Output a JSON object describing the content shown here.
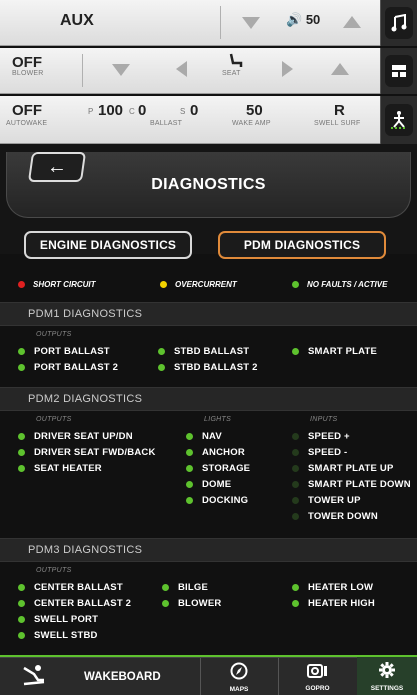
{
  "topbar": {
    "row1": {
      "source": "AUX",
      "volume": "50"
    },
    "row2": {
      "blower_value": "OFF",
      "blower_label": "BLOWER",
      "seat_label": "SEAT"
    },
    "row3": {
      "autowake_value": "OFF",
      "autowake_label": "AUTOWAKE",
      "ballast_p_prefix": "P",
      "ballast_p": "100",
      "ballast_c_prefix": "C",
      "ballast_c": "0",
      "ballast_s_prefix": "S",
      "ballast_s": "0",
      "ballast_label": "BALLAST",
      "wake_amp_value": "50",
      "wake_amp_label": "WAKE AMP",
      "swell_value": "R",
      "swell_label": "SWELL SURF"
    }
  },
  "header": {
    "back_glyph": "←",
    "title": "DIAGNOSTICS",
    "tabs": [
      "ENGINE DIAGNOSTICS",
      "PDM DIAGNOSTICS"
    ]
  },
  "legend": {
    "short_circuit": "SHORT CIRCUIT",
    "overcurrent": "OVERCURRENT",
    "no_faults": "NO FAULTS / ACTIVE"
  },
  "pdm1": {
    "title": "PDM1 DIAGNOSTICS",
    "outputs_label": "OUTPUTS",
    "col1": [
      "PORT BALLAST",
      "PORT BALLAST 2"
    ],
    "col2": [
      "STBD BALLAST",
      "STBD BALLAST 2"
    ],
    "col3": [
      "SMART PLATE"
    ]
  },
  "pdm2": {
    "title": "PDM2 DIAGNOSTICS",
    "outputs_label": "OUTPUTS",
    "lights_label": "LIGHTS",
    "inputs_label": "INPUTS",
    "outputs": [
      "DRIVER SEAT UP/DN",
      "DRIVER SEAT FWD/BACK",
      "SEAT HEATER"
    ],
    "lights": [
      "NAV",
      "ANCHOR",
      "STORAGE",
      "DOME",
      "DOCKING"
    ],
    "inputs": [
      "SPEED +",
      "SPEED -",
      "SMART PLATE UP",
      "SMART PLATE DOWN",
      "TOWER UP",
      "TOWER DOWN"
    ]
  },
  "pdm3": {
    "title": "PDM3 DIAGNOSTICS",
    "outputs_label": "OUTPUTS",
    "col1": [
      "CENTER BALLAST",
      "CENTER BALLAST 2",
      "SWELL PORT",
      "SWELL STBD"
    ],
    "col2": [
      "BILGE",
      "BLOWER"
    ],
    "col3": [
      "HEATER LOW",
      "HEATER HIGH"
    ]
  },
  "bottom_nav": {
    "mode": "WAKEBOARD",
    "maps": "MAPS",
    "gopro": "GOPRO",
    "settings": "SETTINGS"
  },
  "colors": {
    "accent_orange": "#e08a3a",
    "status_green": "#5ec22e",
    "status_yellow": "#f2d200",
    "status_red": "#e02020"
  }
}
